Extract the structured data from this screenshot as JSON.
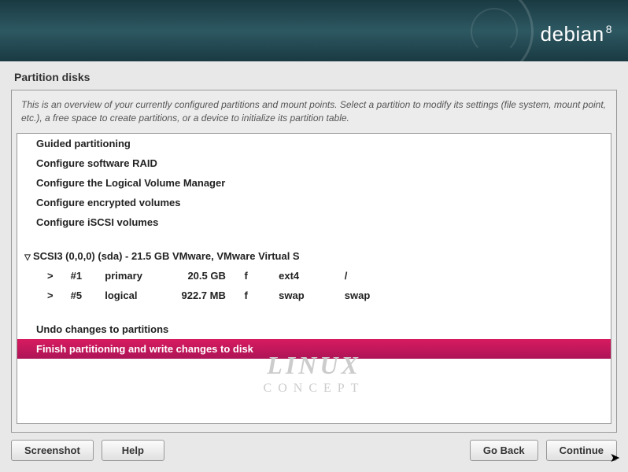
{
  "brand": {
    "name": "debian",
    "version": "8"
  },
  "title": "Partition disks",
  "description": "This is an overview of your currently configured partitions and mount points. Select a partition to modify its settings (file system, mount point, etc.), a free space to create partitions, or a device to initialize its partition table.",
  "menu": {
    "guided": "Guided partitioning",
    "raid": "Configure software RAID",
    "lvm": "Configure the Logical Volume Manager",
    "encrypted": "Configure encrypted volumes",
    "iscsi": "Configure iSCSI volumes"
  },
  "disk": {
    "label": "SCSI3 (0,0,0) (sda) - 21.5 GB VMware, VMware Virtual S",
    "partitions": [
      {
        "arrow": ">",
        "num": "#1",
        "type": "primary",
        "size": "20.5 GB",
        "flag": "f",
        "fs": "ext4",
        "mount": "/"
      },
      {
        "arrow": ">",
        "num": "#5",
        "type": "logical",
        "size": "922.7 MB",
        "flag": "f",
        "fs": "swap",
        "mount": "swap"
      }
    ]
  },
  "actions": {
    "undo": "Undo changes to partitions",
    "finish": "Finish partitioning and write changes to disk"
  },
  "buttons": {
    "screenshot": "Screenshot",
    "help": "Help",
    "goback": "Go Back",
    "continue": "Continue"
  },
  "watermark": {
    "line1": "LINUX",
    "line2": "CONCEPT"
  }
}
